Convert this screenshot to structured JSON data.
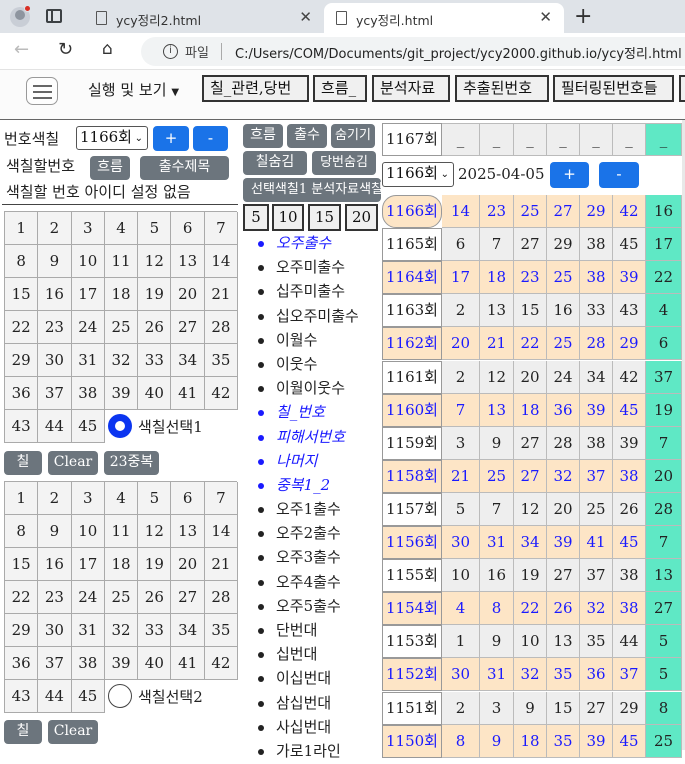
{
  "browser": {
    "tabs": [
      {
        "title": "ycy정리2.html",
        "active": false
      },
      {
        "title": "ycy정리.html",
        "active": true
      }
    ],
    "file_label": "파일",
    "url": "C:/Users/COM/Documents/git_project/ycy2000.github.io/ycy정리.html"
  },
  "toolbar": {
    "menu_label": "실행 및 보기",
    "buttons": [
      "칠_관련,당번",
      "흐름_",
      "분석자료",
      "추출된번호",
      "필터링된번호들",
      ""
    ]
  },
  "left": {
    "color_label": "번호색칠",
    "round_select": "1166회",
    "plus": "+",
    "minus": "-",
    "paint_num_label": "색칠할번호",
    "flow_btn": "흐름",
    "title_btn": "출수제목",
    "id_status": "색칠할 번호 아이디 설정 없음",
    "numbers": [
      1,
      2,
      3,
      4,
      5,
      6,
      7,
      8,
      9,
      10,
      11,
      12,
      13,
      14,
      15,
      16,
      17,
      18,
      19,
      20,
      21,
      22,
      23,
      24,
      25,
      26,
      27,
      28,
      29,
      30,
      31,
      32,
      33,
      34,
      35,
      36,
      37,
      38,
      39,
      40,
      41,
      42,
      43,
      44,
      45
    ],
    "select1_label": "색칠선택1",
    "select2_label": "색칠선택2",
    "paint_btn": "칠",
    "clear_btn": "Clear",
    "dup_btn": "23중복"
  },
  "middle": {
    "flow_btn": "흐름",
    "draw_btn": "출수",
    "hide_btn": "숨기기",
    "hide_paint_btn": "칠숨김",
    "hide_duty_btn": "당번숨김",
    "analysis_btn": "선택색칠1 분석자료색칠",
    "range_btns": [
      "5",
      "10",
      "15",
      "20"
    ],
    "filters": [
      {
        "label": "오주출수",
        "highlighted": true
      },
      {
        "label": "오주미출수",
        "highlighted": false
      },
      {
        "label": "십주미출수",
        "highlighted": false
      },
      {
        "label": "십오주미출수",
        "highlighted": false
      },
      {
        "label": "이월수",
        "highlighted": false
      },
      {
        "label": "이웃수",
        "highlighted": false
      },
      {
        "label": "이월이웃수",
        "highlighted": false
      },
      {
        "label": "칠_번호",
        "highlighted": true
      },
      {
        "label": "피해서번호",
        "highlighted": true
      },
      {
        "label": "나머지",
        "highlighted": true
      },
      {
        "label": "중복1_2",
        "highlighted": true
      },
      {
        "label": "오주1출수",
        "highlighted": false
      },
      {
        "label": "오주2출수",
        "highlighted": false
      },
      {
        "label": "오주3출수",
        "highlighted": false
      },
      {
        "label": "오주4출수",
        "highlighted": false
      },
      {
        "label": "오주5출수",
        "highlighted": false
      },
      {
        "label": "단번대",
        "highlighted": false
      },
      {
        "label": "십번대",
        "highlighted": false
      },
      {
        "label": "이십번대",
        "highlighted": false
      },
      {
        "label": "삼십번대",
        "highlighted": false
      },
      {
        "label": "사십번대",
        "highlighted": false
      },
      {
        "label": "가로1라인",
        "highlighted": false
      }
    ]
  },
  "right": {
    "next_round": "1167회",
    "next_placeholders": [
      "_",
      "_",
      "_",
      "_",
      "_",
      "_",
      "_"
    ],
    "round_select": "1166회",
    "date": "2025-04-05",
    "plus": "+",
    "minus": "-",
    "rows": [
      {
        "round": "1166회",
        "nums": [
          14,
          23,
          25,
          27,
          29,
          42
        ],
        "bonus": 16
      },
      {
        "round": "1165회",
        "nums": [
          6,
          7,
          27,
          29,
          38,
          45
        ],
        "bonus": 17
      },
      {
        "round": "1164회",
        "nums": [
          17,
          18,
          23,
          25,
          38,
          39
        ],
        "bonus": 22
      },
      {
        "round": "1163회",
        "nums": [
          2,
          13,
          15,
          16,
          33,
          43
        ],
        "bonus": 4
      },
      {
        "round": "1162회",
        "nums": [
          20,
          21,
          22,
          25,
          28,
          29
        ],
        "bonus": 6
      },
      {
        "round": "1161회",
        "nums": [
          2,
          12,
          20,
          24,
          34,
          42
        ],
        "bonus": 37
      },
      {
        "round": "1160회",
        "nums": [
          7,
          13,
          18,
          36,
          39,
          45
        ],
        "bonus": 19
      },
      {
        "round": "1159회",
        "nums": [
          3,
          9,
          27,
          28,
          38,
          39
        ],
        "bonus": 7
      },
      {
        "round": "1158회",
        "nums": [
          21,
          25,
          27,
          32,
          37,
          38
        ],
        "bonus": 20
      },
      {
        "round": "1157회",
        "nums": [
          5,
          7,
          12,
          20,
          25,
          26
        ],
        "bonus": 28
      },
      {
        "round": "1156회",
        "nums": [
          30,
          31,
          34,
          39,
          41,
          45
        ],
        "bonus": 7
      },
      {
        "round": "1155회",
        "nums": [
          10,
          16,
          19,
          27,
          37,
          38
        ],
        "bonus": 13
      },
      {
        "round": "1154회",
        "nums": [
          4,
          8,
          22,
          26,
          32,
          38
        ],
        "bonus": 27
      },
      {
        "round": "1153회",
        "nums": [
          1,
          9,
          10,
          13,
          35,
          44
        ],
        "bonus": 5
      },
      {
        "round": "1152회",
        "nums": [
          30,
          31,
          32,
          35,
          36,
          37
        ],
        "bonus": 5
      },
      {
        "round": "1151회",
        "nums": [
          2,
          3,
          9,
          15,
          27,
          29
        ],
        "bonus": 8
      },
      {
        "round": "1150회",
        "nums": [
          8,
          9,
          18,
          35,
          39,
          45
        ],
        "bonus": 25
      }
    ]
  },
  "colors": {
    "peach": "#fde5c6",
    "lightgray": "#eeeeee",
    "mint": "#5fe8c5",
    "blue_text": "#1a1aff",
    "bootstrap_blue": "#1a73e8",
    "bootstrap_gray": "#6c757d"
  }
}
